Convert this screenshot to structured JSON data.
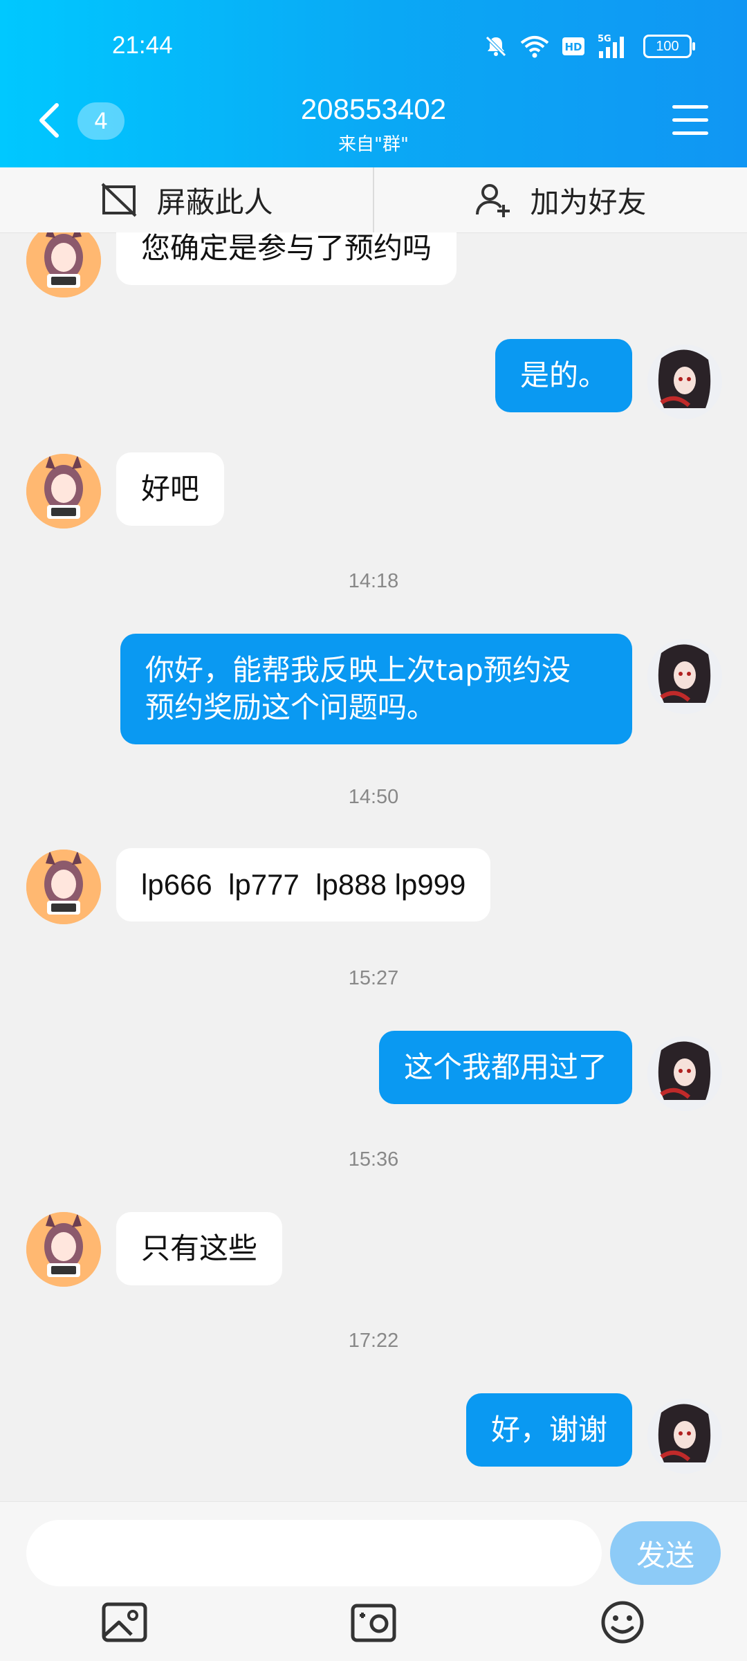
{
  "status_bar": {
    "time": "21:44",
    "network": "5G",
    "hd": "HD",
    "battery": "100"
  },
  "header": {
    "unread_count": "4",
    "title": "208553402",
    "subtitle": "来自\"群\""
  },
  "actions": {
    "block_label": "屏蔽此人",
    "add_friend_label": "加为好友"
  },
  "messages": [
    {
      "side": "in",
      "text": "您确定是参与了预约吗"
    },
    {
      "side": "out",
      "text": "是的。"
    },
    {
      "side": "in",
      "text": "好吧"
    },
    {
      "timestamp": "14:18"
    },
    {
      "side": "out",
      "text_line1": "你好，能帮我反映上次tap预约没",
      "text_line2": "预约奖励这个问题吗。"
    },
    {
      "timestamp": "14:50"
    },
    {
      "side": "in",
      "text": "lp666  lp777  lp888 lp999"
    },
    {
      "timestamp": "15:27"
    },
    {
      "side": "out",
      "text": "这个我都用过了"
    },
    {
      "timestamp": "15:36"
    },
    {
      "side": "in",
      "text": "只有这些"
    },
    {
      "timestamp": "17:22"
    },
    {
      "side": "out",
      "text": "好，谢谢"
    }
  ],
  "input": {
    "value": "",
    "send_label": "发送"
  },
  "colors": {
    "header_start": "#00c8ff",
    "header_end": "#1096f3",
    "outgoing_bubble": "#0a99f2",
    "send_button": "#8dcbf7"
  }
}
